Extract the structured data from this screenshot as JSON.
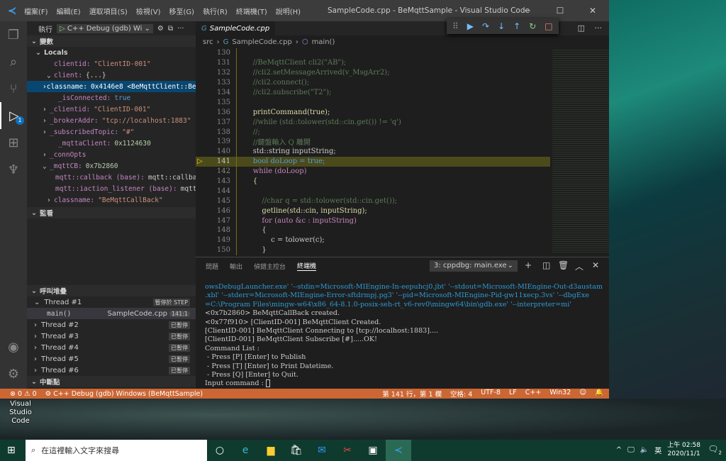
{
  "window": {
    "title": "SampleCode.cpp - BeMqttSample - Visual Studio Code",
    "menu": [
      "檔案(F)",
      "編輯(E)",
      "選取項目(S)",
      "檢視(V)",
      "移至(G)",
      "執行(R)",
      "終端機(T)",
      "說明(H)"
    ]
  },
  "activity": {
    "debug_badge": "1"
  },
  "sidebar": {
    "run_label": "執行",
    "config": "C++ Debug (gdb) Wi",
    "variables_title": "變數",
    "locals_title": "Locals",
    "vars": [
      {
        "name": "clientid:",
        "value": "\"ClientID-001\"",
        "kind": "s"
      },
      {
        "name": "client:",
        "value": "{...}",
        "kind": "v"
      },
      {
        "name": "classname:",
        "value": "0x4146e8 <BeMqttClient::BeM…",
        "kind": "v"
      },
      {
        "name": "_isConnected:",
        "value": "true",
        "kind": "b"
      },
      {
        "name": "_clientid:",
        "value": "\"ClientID-001\"",
        "kind": "s"
      },
      {
        "name": "_brokerAddr:",
        "value": "\"tcp://localhost:1883\"",
        "kind": "s"
      },
      {
        "name": "_subscribedTopic:",
        "value": "\"#\"",
        "kind": "s"
      },
      {
        "name": "_mqttaClient:",
        "value": "0x1124630",
        "kind": "n"
      },
      {
        "name": "_connOpts",
        "value": "",
        "kind": "v"
      },
      {
        "name": "_mqttCB:",
        "value": "0x7b2860",
        "kind": "n"
      },
      {
        "name": "mqtt::callback (base):",
        "value": "mqtt::callback",
        "kind": "v"
      },
      {
        "name": "mqtt::iaction_listener (base):",
        "value": "mqtt:…",
        "kind": "v"
      },
      {
        "name": "classname:",
        "value": "\"BeMqttCallBack\"",
        "kind": "s"
      }
    ],
    "watch_title": "監看",
    "callstack_title": "呼叫堆疊",
    "threads": [
      {
        "label": "Thread #1",
        "tag": "暫停於 STEP"
      },
      {
        "label": "Thread #2",
        "tag": "已暫停"
      },
      {
        "label": "Thread #3",
        "tag": "已暫停"
      },
      {
        "label": "Thread #4",
        "tag": "已暫停"
      },
      {
        "label": "Thread #5",
        "tag": "已暫停"
      },
      {
        "label": "Thread #6",
        "tag": "已暫停"
      }
    ],
    "frame": {
      "fn": "main()",
      "file": "SampleCode.cpp",
      "pos": "141:1"
    },
    "breakpoints_title": "中斷點"
  },
  "editor": {
    "tab": "SampleCode.cpp",
    "breadcrumb": [
      "src",
      "SampleCode.cpp",
      "main()"
    ],
    "current_line": 141,
    "lines": [
      {
        "no": "130",
        "html": ""
      },
      {
        "no": "131",
        "text": "    //BeMqttClient cli2(\"AB\");",
        "cls": "cm"
      },
      {
        "no": "132",
        "text": "    //cli2.setMessageArrived(v_MsgArr2);",
        "cls": "cm"
      },
      {
        "no": "133",
        "text": "    //cli2.connect();",
        "cls": "cm"
      },
      {
        "no": "134",
        "text": "    //cli2.subscribe(\"T2\");",
        "cls": "cm"
      },
      {
        "no": "135",
        "text": ""
      },
      {
        "no": "136",
        "text": "    printCommand(true);",
        "cls": "fn"
      },
      {
        "no": "137",
        "text": "    //while (std::tolower(std::cin.get()) != 'q')",
        "cls": "cm"
      },
      {
        "no": "138",
        "text": "    //;",
        "cls": "cm"
      },
      {
        "no": "139",
        "text": "    //鍵盤輸入 Q 離開",
        "cls": "cm"
      },
      {
        "no": "140",
        "text": "    std::string inputString;",
        "cls": "v"
      },
      {
        "no": "141",
        "text": "    bool doLoop = true;",
        "cls": "kw"
      },
      {
        "no": "142",
        "text": "    while (doLoop)",
        "cls": "ct"
      },
      {
        "no": "143",
        "text": "    {",
        "cls": "fn"
      },
      {
        "no": "144",
        "text": ""
      },
      {
        "no": "145",
        "text": "        //char q = std::tolower(std::cin.get());",
        "cls": "cm"
      },
      {
        "no": "146",
        "text": "        getline(std::cin, inputString);",
        "cls": "fn"
      },
      {
        "no": "147",
        "text": "        for (auto &c : inputString)",
        "cls": "ct"
      },
      {
        "no": "148",
        "text": "        {",
        "cls": "v"
      },
      {
        "no": "149",
        "text": "            c = tolower(c);",
        "cls": "v"
      },
      {
        "no": "150",
        "text": "        }",
        "cls": "v"
      }
    ]
  },
  "panel": {
    "tabs": [
      "問題",
      "輸出",
      "偵錯主控台",
      "終端機"
    ],
    "active_tab": "終端機",
    "terminal_select": "3: cppdbg: main.exe",
    "terminal_blue": [
      "owsDebugLauncher.exe' '--stdin=Microsoft-MIEngine-In-eepuhcj0.jbt' '--stdout=Microsoft-MIEngine-Out-d3austam",
      ".xbl' '--stderr=Microsoft-MIEngine-Error-sftdrmpj.pg3' '--pid=Microsoft-MIEngine-Pid-gw11xecp.3vs' '--dbgExe",
      "=C:\\Program Files\\mingw-w64\\x86_64-8.1.0-posix-seh-rt_v6-rev0\\mingw64\\bin\\gdb.exe' '--interpreter=mi'"
    ],
    "terminal": [
      "<0x7b2860> BeMqttCallBack created.",
      "<0x77f910> [ClientID-001] BeMqttClient Created.",
      "[ClientID-001] BeMqttClient Connecting to [tcp://localhost:1883]....",
      "[ClientID-001] BeMqttClient Subscribe [#].....OK!",
      "Command List :",
      " - Press [P] [Enter] to Publish",
      " - Press [T] [Enter] to Print Datetime.",
      " - Press [Q] [Enter] to Quit.",
      "Input command : "
    ]
  },
  "status": {
    "errors": "0",
    "warnings": "0",
    "debug": "C++ Debug (gdb) Windows (BeMqttSample)",
    "position": "第 141 行，第 1 欄",
    "spaces": "空格: 4",
    "encoding": "UTF-8",
    "eol": "LF",
    "language": "C++",
    "platform": "Win32"
  },
  "desktop": {
    "icon_label": "Visual Studio Code"
  },
  "taskbar": {
    "search_placeholder": "在這裡輸入文字來搜尋",
    "time": "上午 02:58",
    "date": "2020/11/1",
    "ime": "英",
    "notifications": "2"
  },
  "colors": {
    "status_bar": "#cc6633",
    "accent": "#0e70c0"
  }
}
